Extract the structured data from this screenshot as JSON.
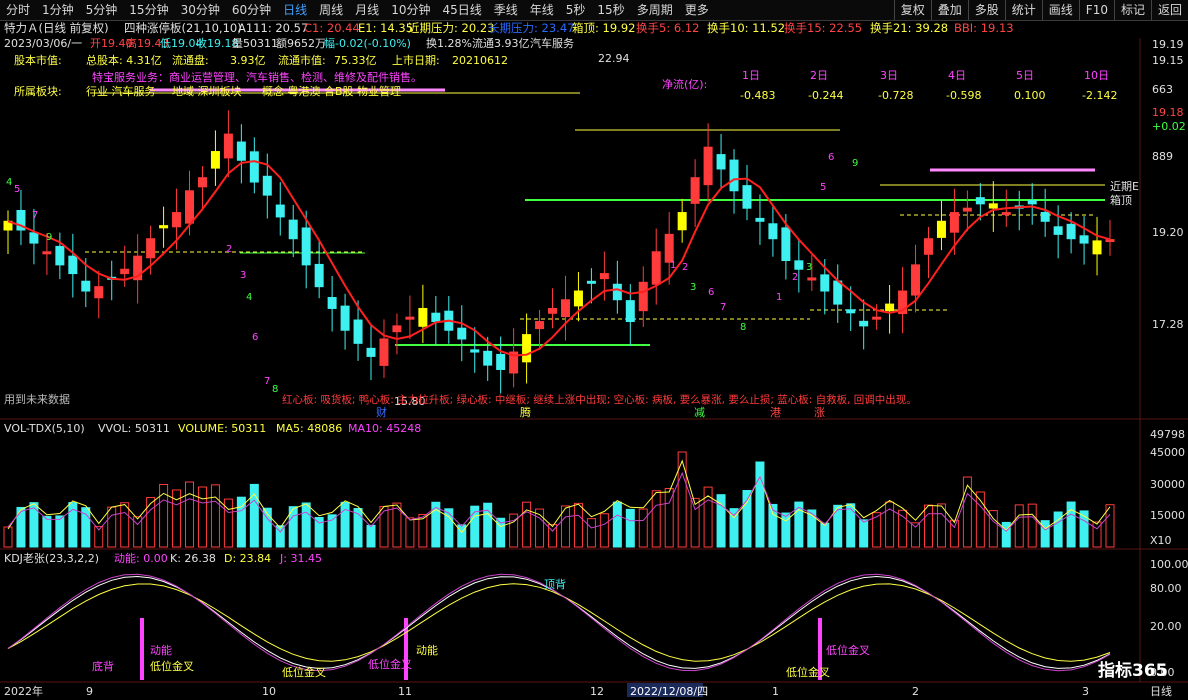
{
  "toolbar": {
    "periods": [
      "分时",
      "1分钟",
      "5分钟",
      "15分钟",
      "30分钟",
      "60分钟",
      "日线",
      "周线",
      "月线",
      "10分钟",
      "45日线",
      "季线",
      "年线",
      "5秒",
      "15秒",
      "多周期",
      "更多"
    ],
    "active_index": 6,
    "right": [
      "复权",
      "叠加",
      "多股",
      "统计",
      "画线",
      "F10",
      "标记",
      "返回"
    ]
  },
  "header": {
    "title": "特力Ａ(日线 前复权)",
    "indicator": "四种涨停板(21,10,10)",
    "a111": "A111: 20.57",
    "c1": "C1: 20.44",
    "e1": "E1: 14.35",
    "pressure": "近期压力: 20.23",
    "pressure2": "长期压力: 23.47",
    "top": "箱顶: 19.92",
    "h5": "换手5: 6.12",
    "h10": "换手10: 11.52",
    "h15": "换手15: 22.55",
    "h21": "换手21: 39.28",
    "bbi": "BBI: 19.13"
  },
  "quote": {
    "date": "2023/03/06/一",
    "open": "开19.40",
    "high": "高19.43",
    "low": "低19.04",
    "close": "收19.18",
    "vol": "量50311",
    "amount": "额9652万",
    "change": "幅-0.02(-0.10%)",
    "turnover": "换1.28%",
    "float": "流通3.93亿",
    "industry": "汽车服务"
  },
  "info": {
    "total_label": "股本市值:",
    "total_value": "总股本: 4.31亿",
    "float_label": "流通盘:",
    "float_value": "3.93亿",
    "mcap_label": "流通市值:",
    "mcap_value": "75.33亿",
    "list_label": "上市日期:",
    "list_value": "20210612",
    "business": "特宝服务业务：商业运营管理、汽车销售、检测、维修及配件销售。",
    "sector_label": "所属板块:",
    "sector": "行业  汽车服务",
    "region": "地域  深圳板块",
    "concept": "概念  粤港澳 合B股 物业管理"
  },
  "flow": {
    "label": "净流(亿):",
    "periods": [
      "1日",
      "2日",
      "3日",
      "4日",
      "5日",
      "10日"
    ],
    "values": [
      "-0.483",
      "-0.244",
      "-0.728",
      "-0.598",
      "0.100",
      "-2.142"
    ]
  },
  "price_axis": [
    "19.19",
    "19.15",
    "663",
    "19.18",
    "+0.02",
    "889",
    "19.20",
    "17.28"
  ],
  "chart_labels": {
    "high_mark": "22.94",
    "low_mark": "15.80",
    "near_pressure": "近期E",
    "box_top": "箱顶",
    "future_data": "用到未来数据",
    "legend_note": "红心板: 吸货板; 鸭心板: 主力拉升板; 绿心板: 中继板; 继续上涨中出现; 空心板: 病板, 要么暴涨, 要么止损; 蓝心板: 自救板, 回调中出现。",
    "markers": [
      "财",
      "腾",
      "减",
      "港",
      "涨"
    ]
  },
  "volume": {
    "title": "VOL-TDX(5,10)",
    "vvol": "VVOL: 50311",
    "volume": "VOLUME: 50311",
    "ma5": "MA5: 48086",
    "ma10": "MA10: 45248",
    "axis": [
      "49798",
      "45000",
      "30000",
      "15000",
      "X10"
    ]
  },
  "kdj": {
    "title": "KDJ老张(23,3,2,2)",
    "momentum": "动能: 0.00",
    "k": "K: 26.38",
    "d": "D: 23.84",
    "j": "J: 31.45",
    "axis": [
      "100.00",
      "80.00",
      "20.00",
      "0.00"
    ],
    "annotations": [
      "顶背",
      "动能",
      "低位金叉",
      "底背",
      "低位金叉",
      "低位金叉",
      "动能",
      "低位金叉",
      "低位金叉"
    ]
  },
  "date_axis": [
    "2022年",
    "9",
    "10",
    "11",
    "12",
    "2022/12/08/四",
    "1",
    "2",
    "3",
    "日线"
  ],
  "watermark": "指标365",
  "colors": {
    "up": "#ff3b3b",
    "down": "#3ef0f0",
    "yellow": "#ffff00",
    "ma": "#ff2020",
    "purple": "#cc44cc",
    "green": "#40ff40"
  },
  "chart_data": {
    "type": "candlestick",
    "title": "特力Ａ(日线 前复权)",
    "x_range": [
      "2022-08",
      "2023-03-06"
    ],
    "ylim": [
      15.8,
      22.94
    ],
    "last_close": 19.18,
    "price_series_close": [
      19.6,
      19.4,
      19.1,
      18.9,
      18.6,
      18.4,
      18.0,
      18.1,
      18.3,
      18.5,
      18.8,
      19.2,
      19.5,
      19.8,
      20.3,
      20.6,
      21.2,
      21.6,
      21.0,
      20.5,
      20.2,
      19.7,
      19.2,
      18.6,
      18.1,
      17.6,
      17.1,
      16.8,
      16.5,
      16.9,
      17.2,
      17.4,
      17.6,
      17.3,
      17.1,
      16.9,
      16.6,
      16.3,
      16.2,
      16.6,
      17.0,
      17.3,
      17.6,
      17.8,
      18.0,
      18.2,
      18.4,
      17.8,
      17.3,
      18.2,
      18.9,
      19.3,
      19.8,
      20.6,
      21.3,
      20.8,
      20.3,
      19.9,
      19.6,
      19.2,
      18.7,
      18.5,
      18.3,
      18.0,
      17.7,
      17.5,
      17.2,
      17.4,
      17.7,
      18.0,
      18.6,
      19.2,
      19.6,
      19.8,
      19.9,
      20.0,
      20.0,
      19.8,
      19.9,
      20.0,
      19.6,
      19.3,
      19.2,
      19.1,
      19.15,
      19.18
    ],
    "volume_axis": [
      15000,
      30000,
      45000
    ],
    "kdj_axis": [
      0,
      20,
      80,
      100
    ]
  }
}
